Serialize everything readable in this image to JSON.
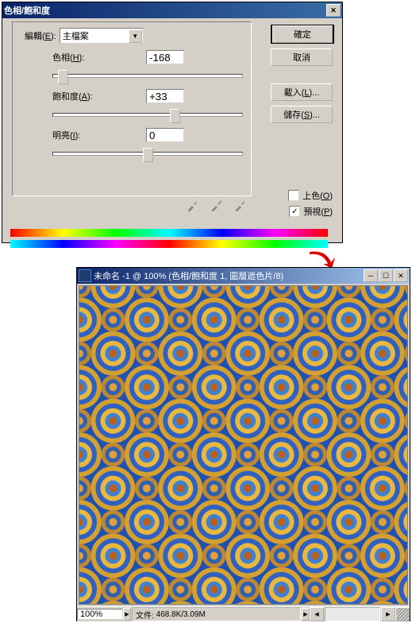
{
  "hs": {
    "title": "色相/飽和度",
    "edit_label": "編輯",
    "edit_hot": "E",
    "master": "主檔案",
    "hue_label": "色相",
    "hue_hot": "H",
    "hue_val": "-168",
    "sat_label": "飽和度",
    "sat_hot": "A",
    "sat_val": "+33",
    "light_label": "明亮",
    "light_hot": "I",
    "light_val": "0",
    "ok": "確定",
    "cancel": "取消",
    "load": "載入",
    "load_hot": "L",
    "save": "儲存",
    "save_hot": "S",
    "colorize": "上色",
    "colorize_hot": "O",
    "preview": "預視",
    "preview_hot": "P",
    "preview_on": "✓"
  },
  "img": {
    "title": "未命名 -1 @ 100% (色相/飽和度 1, 圖層遮色片/8)",
    "zoom": "100%",
    "file_label": "文件:",
    "file_size": "468.8K/3.09M"
  }
}
